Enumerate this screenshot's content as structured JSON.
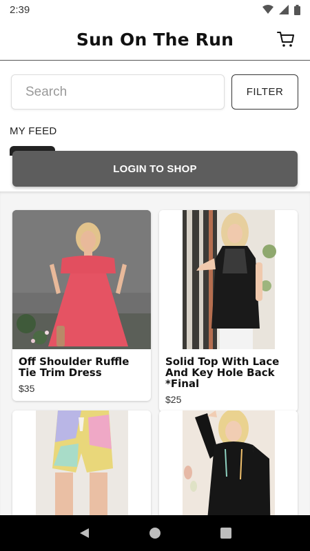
{
  "status_bar": {
    "time": "2:39",
    "icons": [
      "wifi-icon",
      "signal-icon",
      "battery-icon"
    ]
  },
  "header": {
    "title": "Sun On The Run",
    "cart_icon": "cart-icon"
  },
  "search": {
    "placeholder": "Search",
    "value": "",
    "filter_label": "FILTER"
  },
  "feed": {
    "label": "MY FEED"
  },
  "login_banner": {
    "label": "LOGIN TO SHOP"
  },
  "products": [
    {
      "name": "Off Shoulder Ruffle Tie Trim Dress",
      "price": "$35",
      "image": "coral-dress-photo"
    },
    {
      "name": "Solid Top With Lace And Key Hole Back *Final",
      "price": "$25",
      "image": "black-lace-top-photo"
    },
    {
      "name": "",
      "price": "",
      "image": "tie-dye-shorts-photo"
    },
    {
      "name": "",
      "price": "",
      "image": "black-hoodie-photo"
    }
  ],
  "nav_bar": {
    "icons": [
      "back-icon",
      "home-icon",
      "recents-icon"
    ]
  },
  "colors": {
    "login_banner_bg": "#5d5d5d",
    "grid_bg": "#f5f5f5",
    "nav_bar_bg": "#000000"
  }
}
